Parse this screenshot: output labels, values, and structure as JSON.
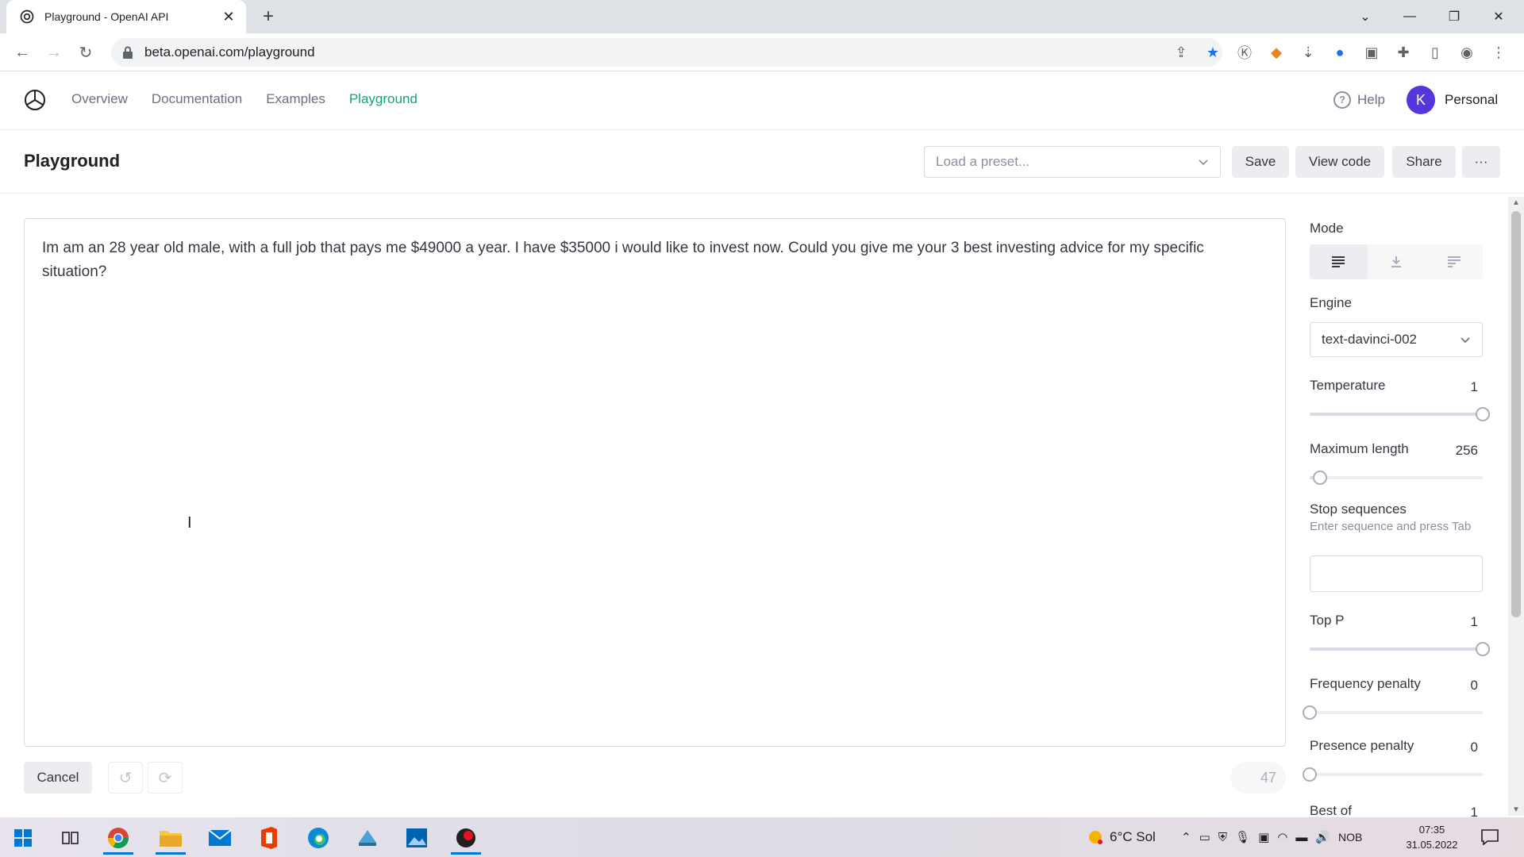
{
  "browser": {
    "tab_title": "Playground - OpenAI API",
    "url": "beta.openai.com/playground",
    "new_tab": "+",
    "close_tab": "✕"
  },
  "header": {
    "nav": [
      {
        "label": "Overview",
        "active": false
      },
      {
        "label": "Documentation",
        "active": false
      },
      {
        "label": "Examples",
        "active": false
      },
      {
        "label": "Playground",
        "active": true
      }
    ],
    "help_label": "Help",
    "avatar_letter": "K",
    "org_label": "Personal"
  },
  "toolbar": {
    "page_title": "Playground",
    "preset_placeholder": "Load a preset...",
    "save_label": "Save",
    "view_code_label": "View code",
    "share_label": "Share",
    "more_label": "···"
  },
  "editor": {
    "prompt_text": "Im am an 28 year old male, with a full job that pays me $49000 a year. I have $35000 i would like to invest now. Could you give me your 3 best investing advice for my specific situation?"
  },
  "bottom": {
    "cancel_label": "Cancel",
    "token_count": "47"
  },
  "settings": {
    "mode_label": "Mode",
    "mode_selected": "complete",
    "engine_label": "Engine",
    "engine_value": "text-davinci-002",
    "temperature_label": "Temperature",
    "temperature_value": "1",
    "temperature_fraction": 1.0,
    "max_length_label": "Maximum length",
    "max_length_value": "256",
    "max_length_fraction": 0.06,
    "stop_label": "Stop sequences",
    "stop_hint": "Enter sequence and press Tab",
    "top_p_label": "Top P",
    "top_p_value": "1",
    "top_p_fraction": 1.0,
    "freq_label": "Frequency penalty",
    "freq_value": "0",
    "freq_fraction": 0.0,
    "presence_label": "Presence penalty",
    "presence_value": "0",
    "presence_fraction": 0.0,
    "best_of_label": "Best of",
    "best_of_value": "1"
  },
  "taskbar": {
    "weather": "6°C Sol",
    "language": "NOB",
    "time": "07:35",
    "date": "31.05.2022"
  },
  "colors": {
    "accent": "#10a37f",
    "avatar": "#5436da",
    "taskbar_active": "#0078d4"
  }
}
